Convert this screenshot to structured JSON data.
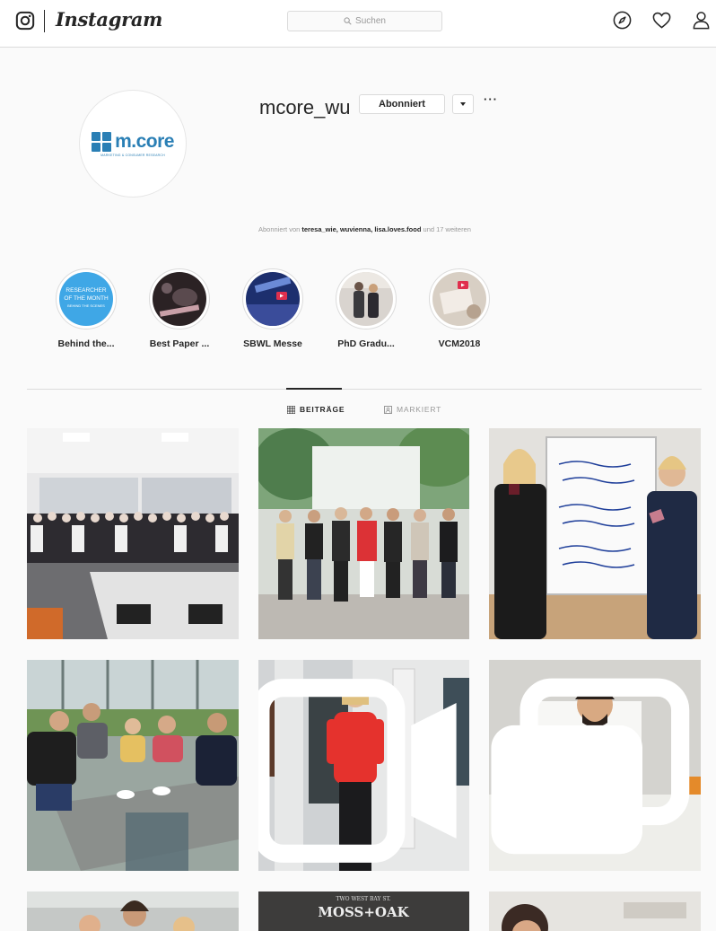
{
  "nav": {
    "wordmark": "Instagram",
    "search_placeholder": "Suchen",
    "icons": [
      "instagram-logo-icon",
      "search-icon",
      "compass-icon",
      "heart-icon",
      "user-icon"
    ]
  },
  "profile": {
    "username": "mcore_wu",
    "follow_button": "Abonniert",
    "more": "···",
    "avatar_logo_text": "m.core",
    "avatar_logo_subtext": "MARKETING & CONSUMER RESEARCH",
    "followed_by": {
      "prefix": "Abonniert von",
      "users": [
        "teresa_wie",
        "wuvienna",
        "lisa.loves.food"
      ],
      "suffix": "und 17 weiteren"
    }
  },
  "highlights": [
    {
      "label": "Behind the...",
      "cover_text": "RESEARCHER OF THE MONTH BEHIND THE SCENES"
    },
    {
      "label": "Best Paper ..."
    },
    {
      "label": "SBWL Messe"
    },
    {
      "label": "PhD Gradu..."
    },
    {
      "label": "VCM2018"
    }
  ],
  "tabs": [
    {
      "label": "BEITRÄGE",
      "active": true,
      "icon": "grid-icon"
    },
    {
      "label": "MARKIERT",
      "active": false,
      "icon": "tag-icon"
    }
  ],
  "posts": [
    {
      "subject": "group-in-conference-room",
      "badge": null
    },
    {
      "subject": "group-outdoors-greenhouse",
      "badge": null
    },
    {
      "subject": "two-women-flipchart",
      "badge": null
    },
    {
      "subject": "group-cafe-terrace",
      "badge": null
    },
    {
      "subject": "woman-red-sweater",
      "badge": "video-icon"
    },
    {
      "subject": "man-holding-bars",
      "badge": "carousel-icon"
    },
    {
      "subject": "partial-group",
      "badge": null
    },
    {
      "subject": "partial-poster",
      "badge": null
    },
    {
      "subject": "partial-person",
      "badge": null
    }
  ],
  "colors": {
    "brand_blue": "#2a7fb5",
    "border": "#dbdbdb",
    "text": "#262626",
    "muted": "#999999"
  }
}
